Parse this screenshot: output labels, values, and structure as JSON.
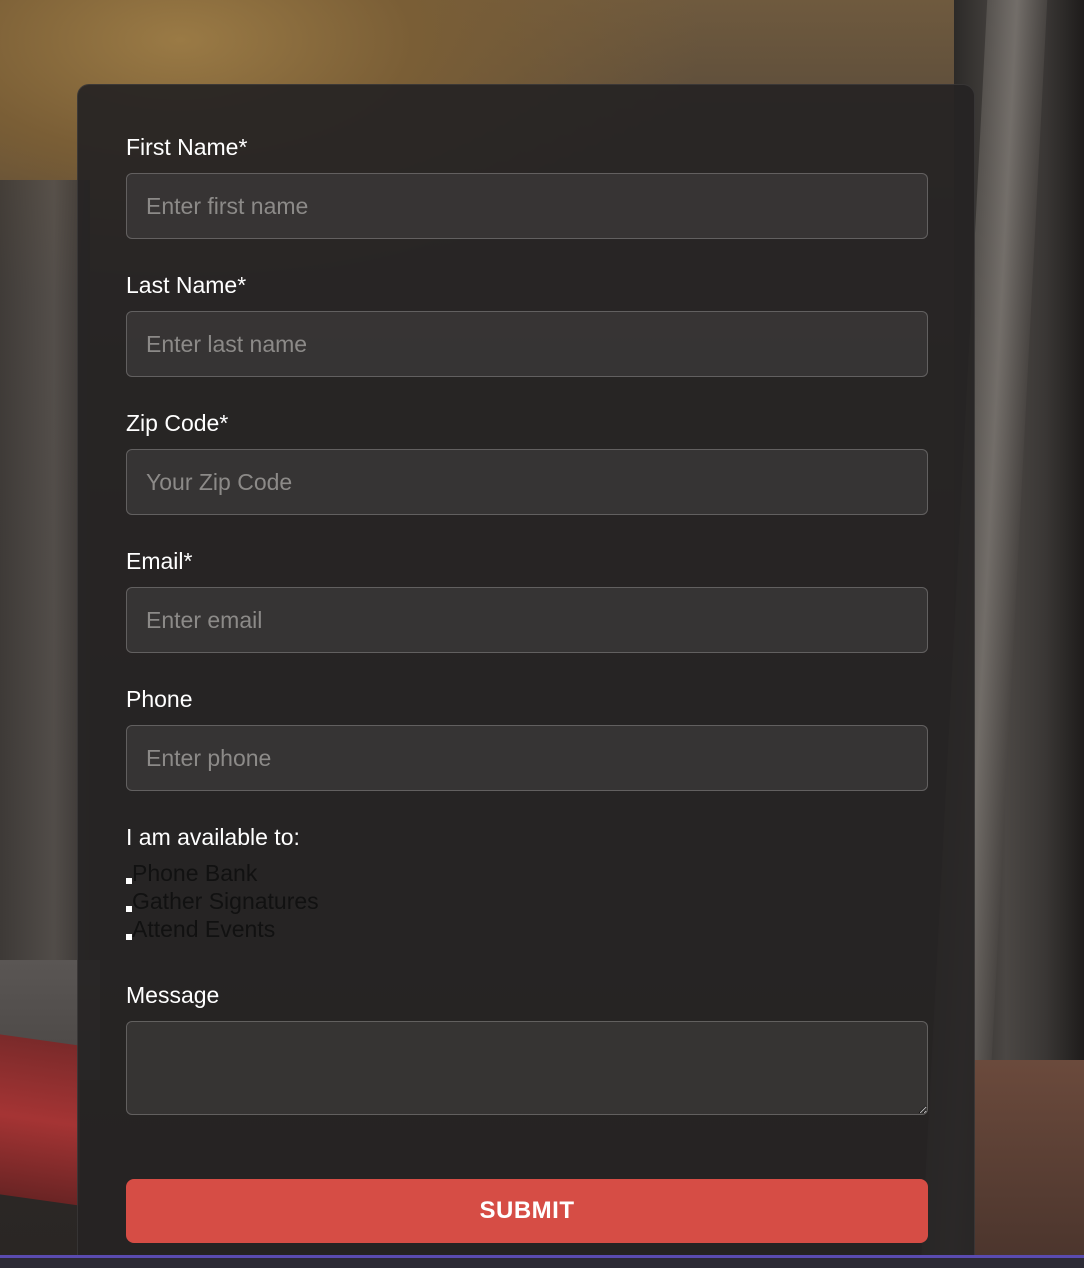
{
  "form": {
    "fields": [
      {
        "label": "First Name*",
        "placeholder": "Enter first name",
        "value": ""
      },
      {
        "label": "Last Name*",
        "placeholder": "Enter last name",
        "value": ""
      },
      {
        "label": "Zip Code*",
        "placeholder": "Your Zip Code",
        "value": ""
      },
      {
        "label": "Email*",
        "placeholder": "Enter email",
        "value": ""
      },
      {
        "label": "Phone",
        "placeholder": "Enter phone",
        "value": ""
      }
    ],
    "availability": {
      "label": "I am available to:",
      "options": [
        {
          "label": "Phone Bank",
          "checked": false
        },
        {
          "label": "Gather Signatures",
          "checked": false
        },
        {
          "label": "Attend Events",
          "checked": false
        }
      ]
    },
    "message": {
      "label": "Message",
      "value": ""
    },
    "submit_label": "SUBMIT"
  },
  "colors": {
    "submit_button": "#d64d45",
    "card_background": "#262423",
    "label_text": "#ffffff",
    "placeholder_text": "#8c8a88"
  }
}
